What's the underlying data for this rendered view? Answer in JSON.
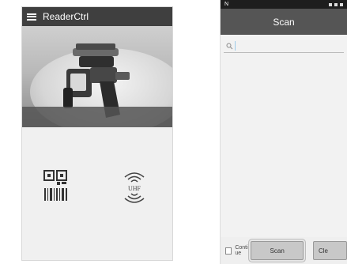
{
  "left_app": {
    "title": "ReaderCtrl",
    "icons": {
      "menu": "hamburger-menu-icon",
      "barcode": "qr-barcode-icon",
      "uhf": "uhf-rfid-icon"
    },
    "uhf_label": "UHF"
  },
  "right_app": {
    "status_left": "N",
    "title": "Scan",
    "search": {
      "placeholder": "",
      "value": ""
    },
    "continue_label": "Contin ue",
    "scan_button": "Scan",
    "clear_button": "Cle"
  },
  "colors": {
    "appbar": "#3f3f3f",
    "titlebar": "#555555",
    "background": "#f0f0f0"
  }
}
